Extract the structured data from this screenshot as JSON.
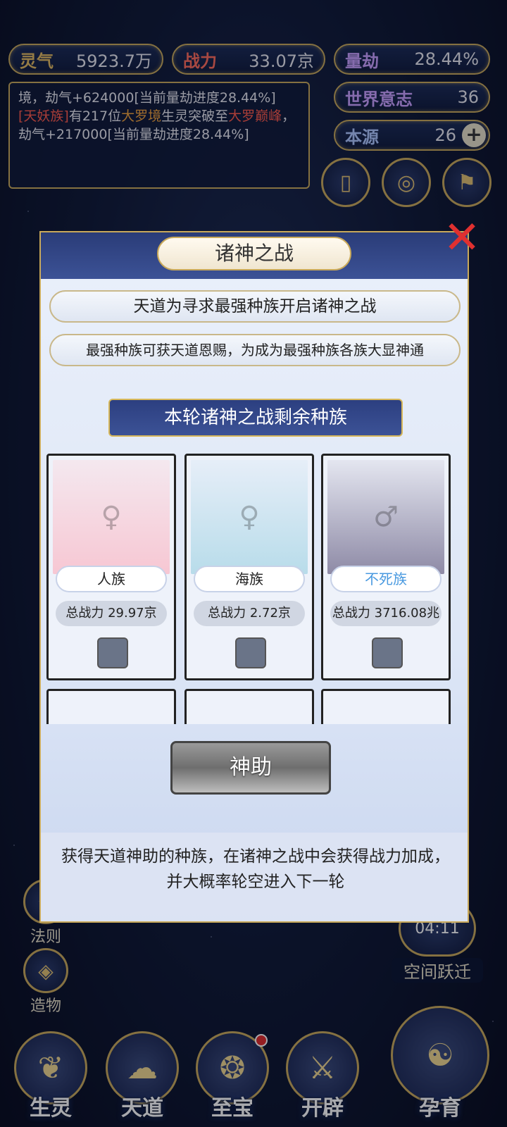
{
  "resources": {
    "lingqi": {
      "label": "灵气",
      "value": "5923.7万"
    },
    "zhanli": {
      "label": "战力",
      "value": "33.07京"
    },
    "liangjie": {
      "label": "量劫",
      "value": "28.44%"
    },
    "shijie": {
      "label": "世界意志",
      "value": "36"
    },
    "benyuan": {
      "label": "本源",
      "value": "26",
      "plus": "+"
    }
  },
  "log": {
    "line1": "境，劫气+624000[当前量劫进度28.44%]",
    "entry2_race": "[天妖族]",
    "entry2_mid": "有217位",
    "entry2_realm": "大罗境",
    "entry2_text": "生灵突破至",
    "entry2_target": "大罗巅峰",
    "entry2_tail": "，劫气+217000[当前量劫进度28.44%]"
  },
  "modal": {
    "title": "诸神之战",
    "close": "✕",
    "line1": "天道为寻求最强种族开启诸神之战",
    "line2": "最强种族可获天道恩赐，为成为最强种族各族大显神通",
    "section": "本轮诸神之战剩余种族",
    "races": [
      {
        "name": "人族",
        "power": "总战力 29.97京"
      },
      {
        "name": "海族",
        "power": "总战力 2.72京"
      },
      {
        "name": "不死族",
        "power": "总战力 3716.08兆"
      }
    ],
    "button": "神助",
    "footer": "获得天道神助的种族，在诸神之战中会获得战力加成，并大概率轮空进入下一轮"
  },
  "side_left": [
    {
      "label": "法则"
    },
    {
      "label": "造物"
    }
  ],
  "side_right": [
    {
      "label": "空间跃迁",
      "timer": "04:11"
    }
  ],
  "bottom_nav": [
    {
      "label": "生灵"
    },
    {
      "label": "天道"
    },
    {
      "label": "至宝"
    },
    {
      "label": "开辟"
    },
    {
      "label": "孕育"
    }
  ],
  "colors": {
    "gold": "#c9a95a",
    "navy": "#1a2a55",
    "red": "#e03030"
  }
}
